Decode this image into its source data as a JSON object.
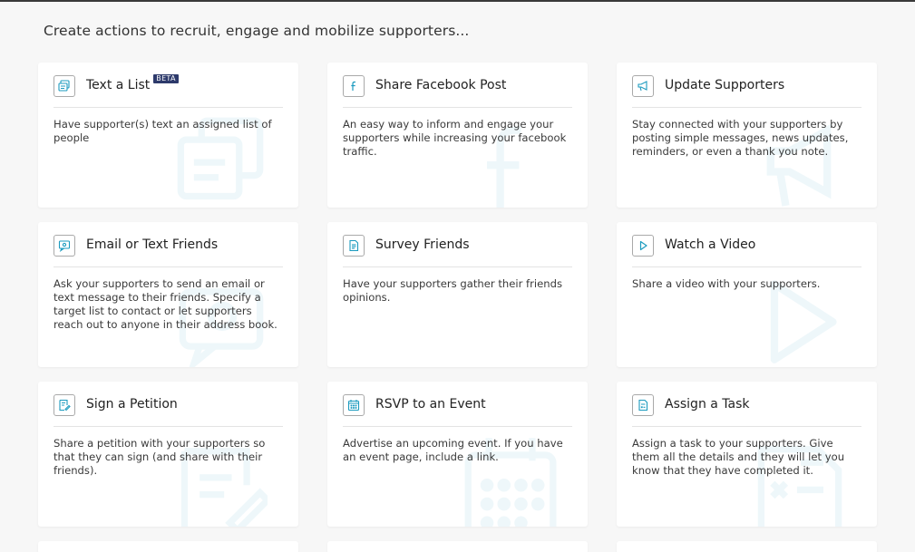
{
  "page": {
    "heading": "Create actions to recruit, engage and mobilize supporters..."
  },
  "colors": {
    "background": "#f7f7f7",
    "card": "#ffffff",
    "accent": "#1c9bbf",
    "watermark": "#eef7fa",
    "beta_badge": "#2d3a6b"
  },
  "actions": [
    {
      "title": "Text a List",
      "badge": "BETA",
      "icon": "message-list-icon",
      "description": "Have supporter(s) text an assigned list of people"
    },
    {
      "title": "Share Facebook Post",
      "icon": "facebook-icon",
      "description": "An easy way to inform and engage your supporters while increasing your facebook traffic."
    },
    {
      "title": "Update Supporters",
      "icon": "megaphone-icon",
      "description": "Stay connected with your supporters by posting simple messages, news updates, reminders, or even a thank you note."
    },
    {
      "title": "Email or Text Friends",
      "icon": "chat-bubbles-icon",
      "description": "Ask your supporters to send an email or text message to their friends. Specify a target list to contact or let supporters reach out to anyone in their address book."
    },
    {
      "title": "Survey Friends",
      "icon": "survey-document-icon",
      "description": "Have your supporters gather their friends opinions."
    },
    {
      "title": "Watch a Video",
      "icon": "play-icon",
      "description": "Share a video with your supporters."
    },
    {
      "title": "Sign a Petition",
      "icon": "petition-pen-icon",
      "description": "Share a petition with your supporters so that they can sign (and share with their friends)."
    },
    {
      "title": "RSVP to an Event",
      "icon": "calendar-icon",
      "description": "Advertise an upcoming event. If you have an event page, include a link."
    },
    {
      "title": "Assign a Task",
      "icon": "task-checklist-icon",
      "description": "Assign a task to your supporters. Give them all the details and they will let you know that they have completed it."
    }
  ]
}
